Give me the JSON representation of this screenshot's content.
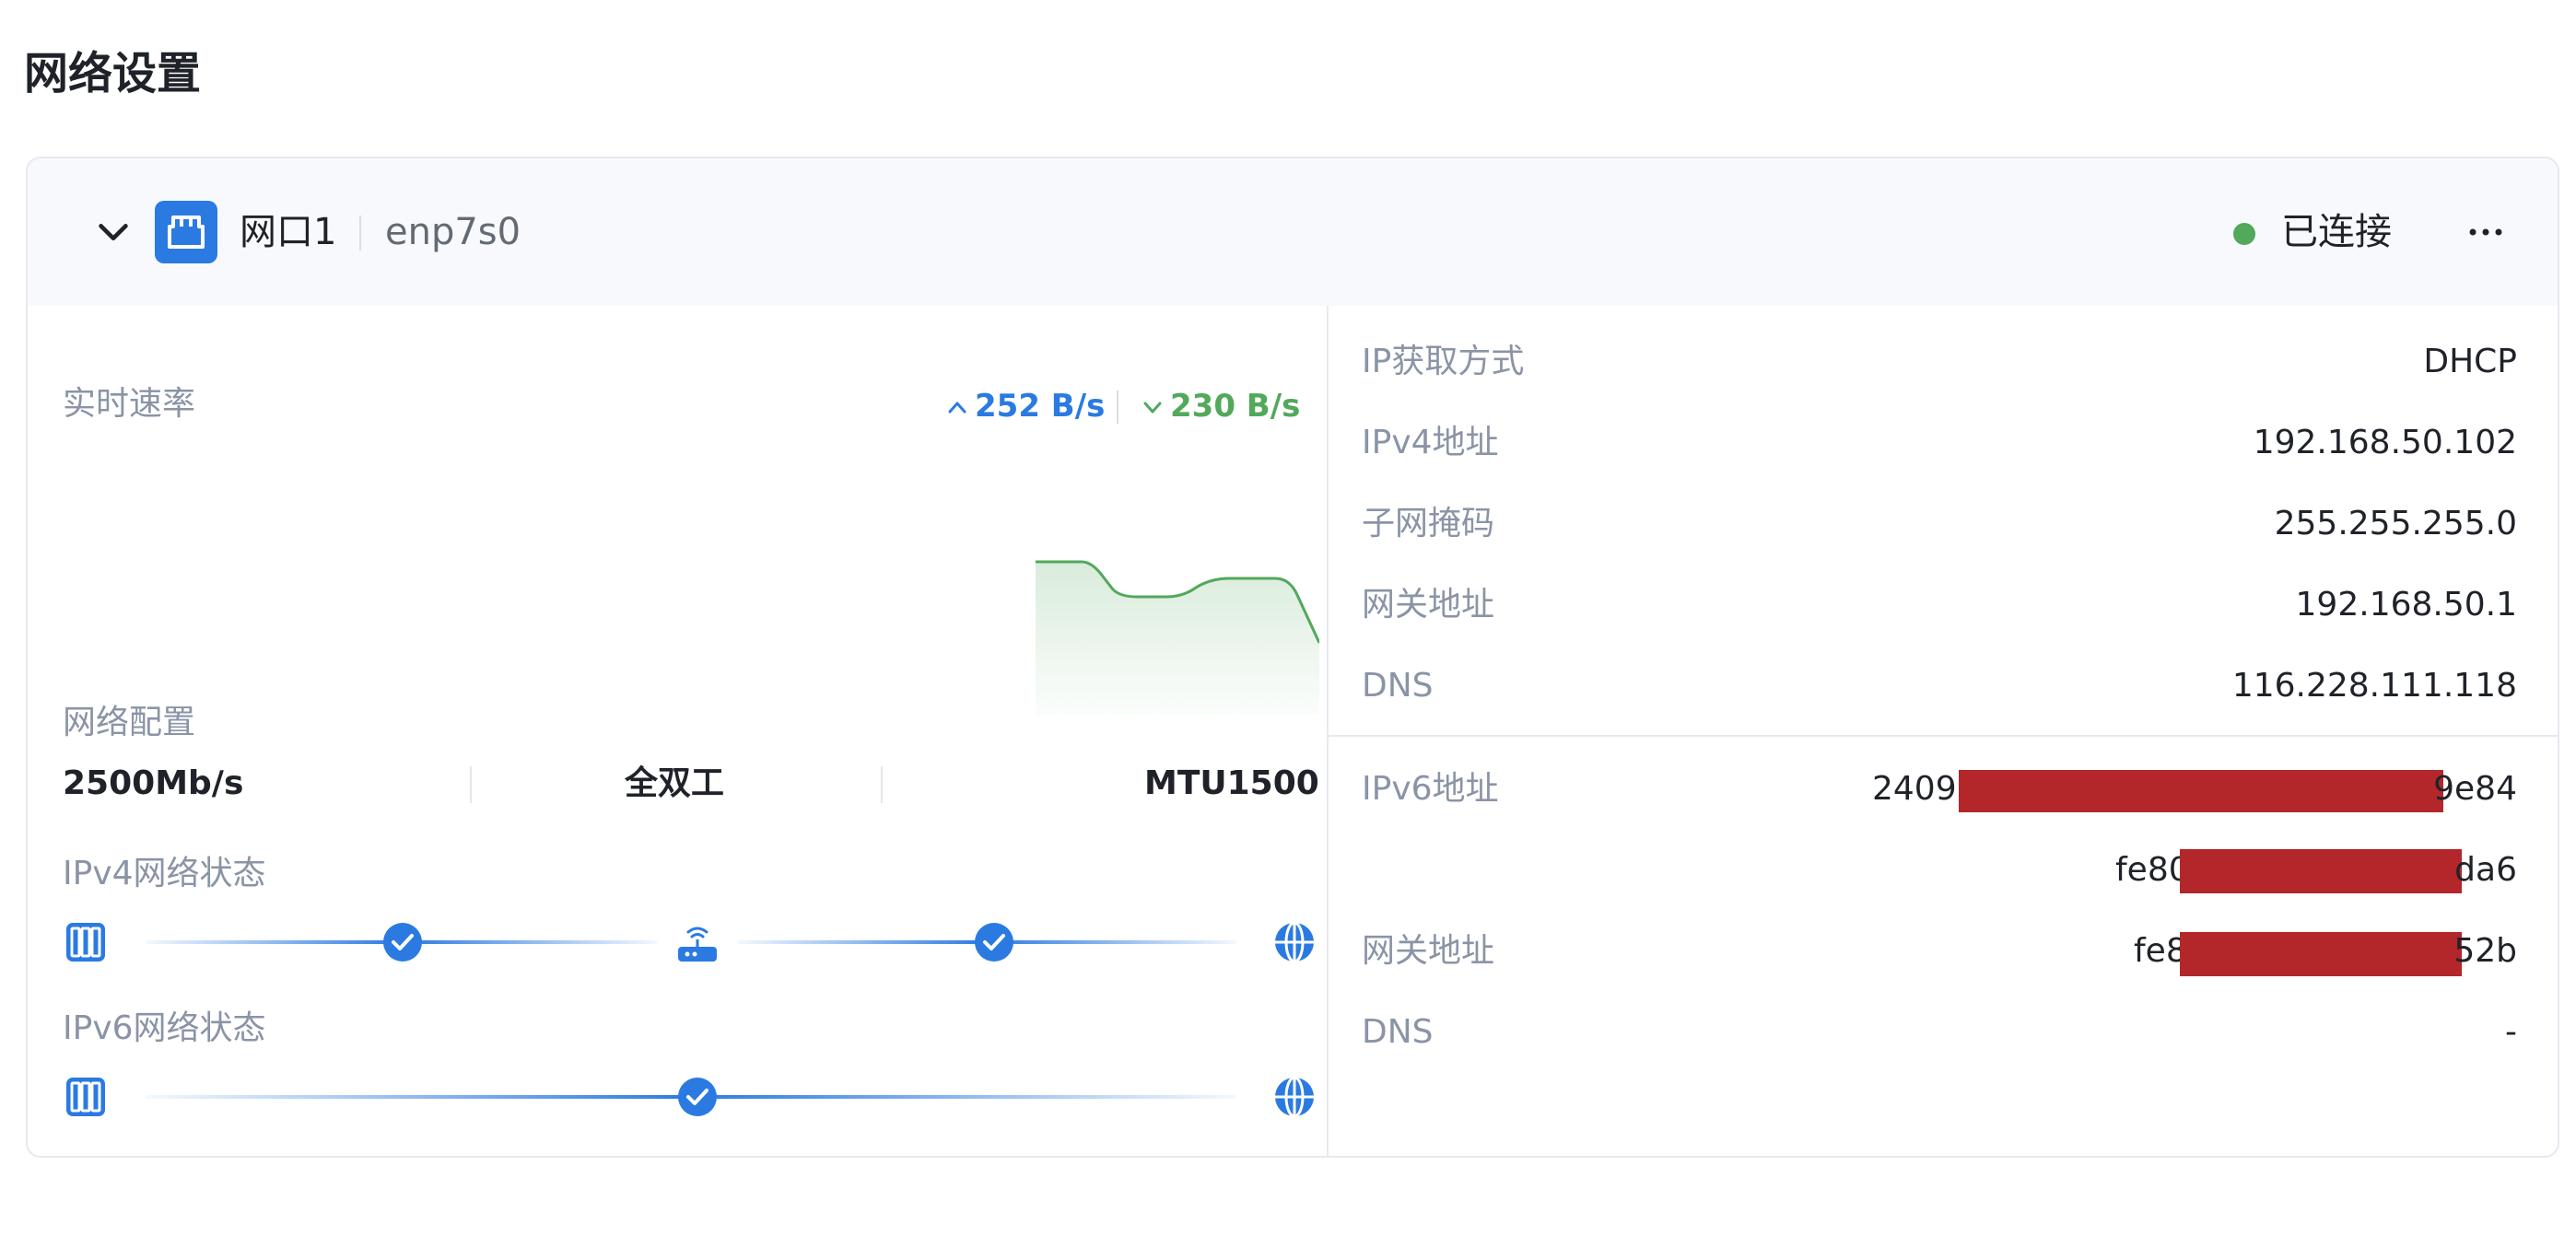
{
  "page_title": "网络设置",
  "card": {
    "port_name": "网口1",
    "device": "enp7s0",
    "status": "已连接",
    "colors": {
      "accent": "#2a7ae2",
      "connected": "#52a85b",
      "redaction": "#b3272b"
    },
    "icons": {
      "collapse": "chevron-down-icon",
      "port": "ethernet-port-icon",
      "more": "more-horizontal-icon"
    }
  },
  "realtime": {
    "label": "实时速率",
    "upload": "252 B/s",
    "download": "230 B/s"
  },
  "config": {
    "label": "网络配置",
    "speed": "2500Mb/s",
    "duplex": "全双工",
    "mtu": "MTU1500"
  },
  "ipv4_status": {
    "label": "IPv4网络状态",
    "icons": [
      "device-icon",
      "check-icon",
      "router-icon",
      "check-icon",
      "globe-icon"
    ]
  },
  "ipv6_status": {
    "label": "IPv6网络状态",
    "icons": [
      "device-icon",
      "check-icon",
      "globe-icon"
    ]
  },
  "ipv4": [
    {
      "label": "IP获取方式",
      "value": "DHCP"
    },
    {
      "label": "IPv4地址",
      "value": "192.168.50.102"
    },
    {
      "label": "子网掩码",
      "value": "255.255.255.0"
    },
    {
      "label": "网关地址",
      "value": "192.168.50.1"
    },
    {
      "label": "DNS",
      "value": "116.228.111.118"
    }
  ],
  "ipv6": {
    "address_label": "IPv6地址",
    "address_1_prefix": "2409:",
    "address_1_suffix": "9e84",
    "address_2_prefix": "fe80",
    "address_2_suffix": "da6",
    "gateway_label": "网关地址",
    "gateway_prefix": "fe8",
    "gateway_suffix": "52b",
    "dns_label": "DNS",
    "dns_value": "-"
  }
}
